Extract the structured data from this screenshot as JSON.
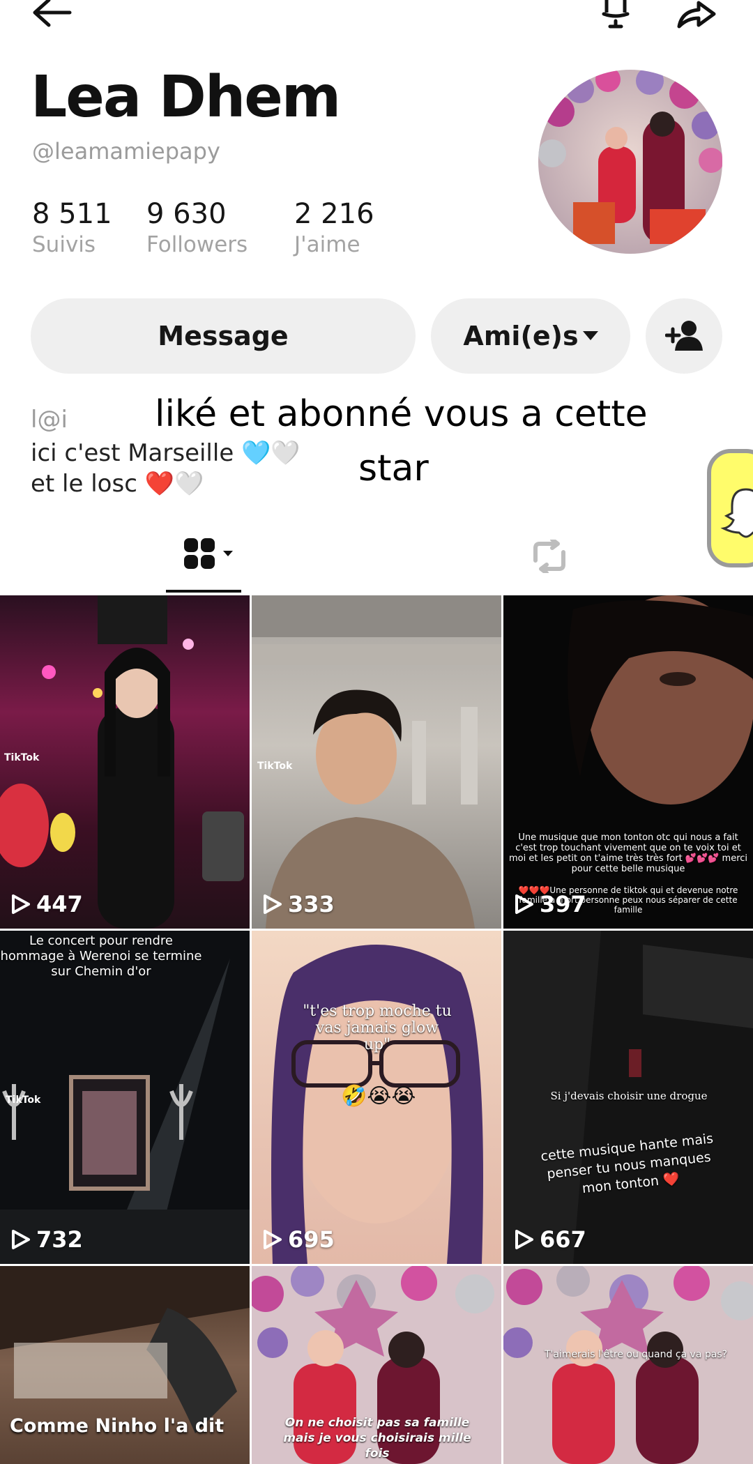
{
  "profile": {
    "name": "Lea Dhem",
    "handle": "@leamamiepapy",
    "stats": [
      {
        "value": "8 511",
        "label": "Suivis"
      },
      {
        "value": "9 630",
        "label": "Followers"
      },
      {
        "value": "2 216",
        "label": "J'aime"
      }
    ]
  },
  "actions": {
    "message": "Message",
    "friends": "Ami(e)s"
  },
  "bio": {
    "line1": "l@i",
    "line2": "ici c'est Marseille 🩵🤍",
    "line3": "et le losc ❤️🤍"
  },
  "overlay_text": {
    "line1": "liké et abonné vous a cette",
    "line2": "star"
  },
  "videos": [
    {
      "plays": "447",
      "watermark": "TikTok"
    },
    {
      "plays": "333",
      "watermark": "TikTok"
    },
    {
      "plays": "397",
      "caption_top": "Une musique que mon tonton otc qui nous a fait c'est trop touchant vivement que on te voix toi et moi et les petit on t'aime très très fort 💕💕💕 merci pour cette belle musique",
      "caption_bottom": "❤️❤️❤️Une personne de tiktok qui et devenue notre famille a mort personne peux nous séparer de cette famille"
    },
    {
      "plays": "732",
      "caption": "Le concert pour rendre hommage à Werenoi se termine sur Chemin d'or",
      "watermark": "TikTok"
    },
    {
      "plays": "695",
      "caption": "\"t'es trop moche tu vas jamais glow up\"",
      "emoji": "🤣😭😭"
    },
    {
      "plays": "667",
      "caption_small": "Si j'devais choisir une drogue",
      "caption": "cette musique hante mais penser tu nous manques mon tonton ❤️"
    },
    {
      "caption": "Comme Ninho l'a dit"
    },
    {
      "caption": "On ne choisit pas sa famille mais je vous choisirais mille fois"
    },
    {
      "caption": "T'aimerais l'être ou quand ça va pas?"
    }
  ]
}
